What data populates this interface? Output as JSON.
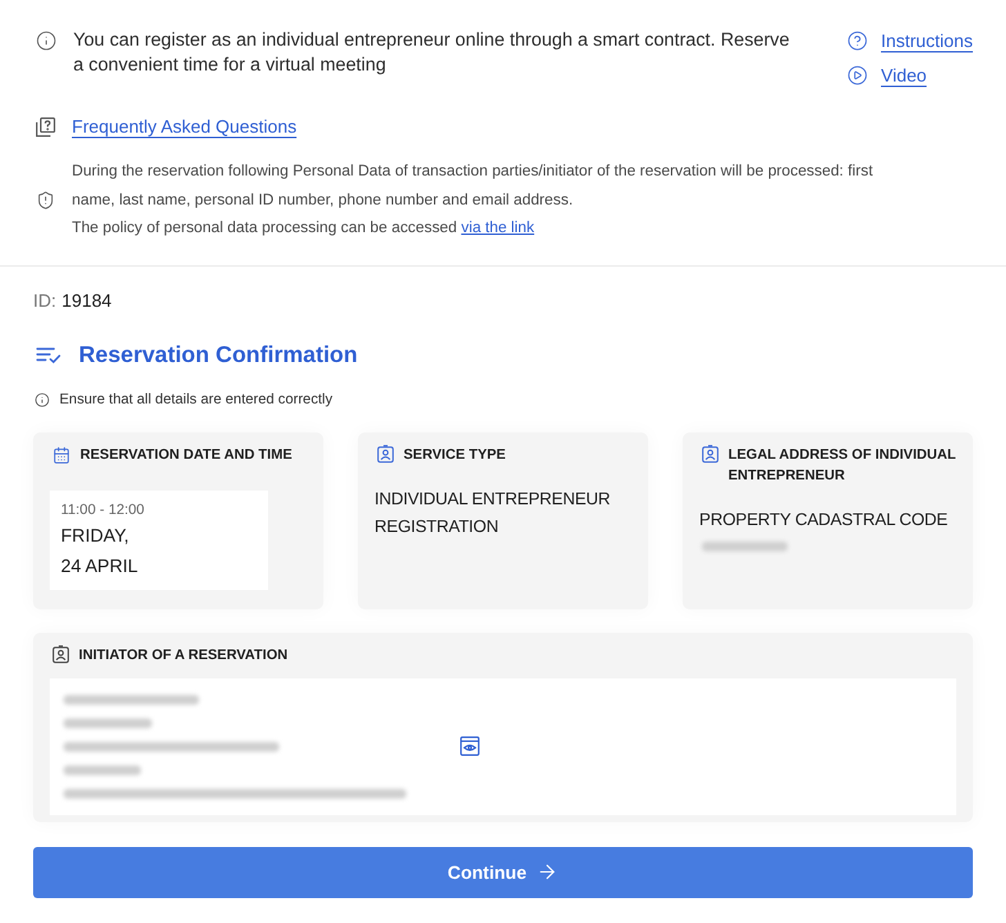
{
  "notice": {
    "text": "You can register as an individual entrepreneur online through a smart contract. Reserve a convenient time for a virtual meeting",
    "links": [
      {
        "kind": "help",
        "label": "Instructions"
      },
      {
        "kind": "video",
        "label": "Video"
      }
    ]
  },
  "faq_link": "Frequently Asked Questions",
  "privacy": {
    "text": "During the reservation following Personal Data of transaction parties/initiator of the reservation will be processed: first name, last name, personal ID number, phone number and email address.",
    "policy_text": "The policy of personal data processing can be accessed",
    "policy_link": "via the link"
  },
  "reservation_id": {
    "label": "ID:",
    "value": "19184"
  },
  "title": "Reservation Confirmation",
  "hint": "Ensure that all details are entered correctly",
  "cards": [
    {
      "kind": "datetime",
      "title": "RESERVATION DATE AND TIME",
      "time": "11:00 - 12:00",
      "day": "FRIDAY,",
      "date": "24 APRIL"
    },
    {
      "kind": "text",
      "title": "SERVICE TYPE",
      "value": "INDIVIDUAL ENTREPRENEUR REGISTRATION"
    },
    {
      "kind": "address",
      "title": "LEGAL ADDRESS OF INDIVIDUAL ENTREPRENEUR",
      "value": "PROPERTY CADASTRAL CODE"
    }
  ],
  "initiator": {
    "title": "INITIATOR OF A RESERVATION"
  },
  "continue_button": "Continue"
}
